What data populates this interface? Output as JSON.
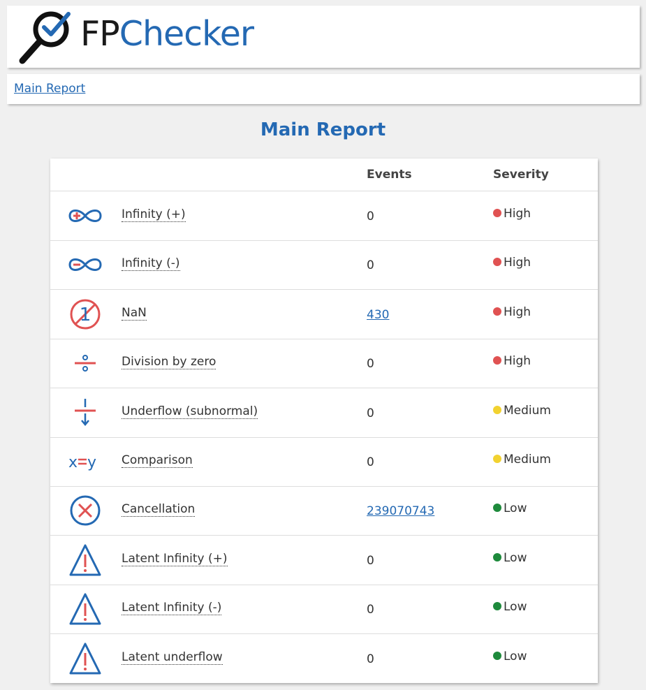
{
  "logo": {
    "fp": "FP",
    "checker": "Checker"
  },
  "nav": {
    "link": "Main Report"
  },
  "page_title": "Main Report",
  "table": {
    "headers": {
      "category": "",
      "events": "Events",
      "severity": "Severity"
    },
    "rows": [
      {
        "icon": "infinity-plus-icon",
        "category": "Infinity (+)",
        "events": "0",
        "events_link": false,
        "severity": "High",
        "severity_color": "#e05252"
      },
      {
        "icon": "infinity-minus-icon",
        "category": "Infinity (-)",
        "events": "0",
        "events_link": false,
        "severity": "High",
        "severity_color": "#e05252"
      },
      {
        "icon": "nan-icon",
        "category": "NaN",
        "events": "430",
        "events_link": true,
        "severity": "High",
        "severity_color": "#e05252"
      },
      {
        "icon": "division-icon",
        "category": "Division by zero",
        "events": "0",
        "events_link": false,
        "severity": "High",
        "severity_color": "#e05252"
      },
      {
        "icon": "underflow-icon",
        "category": "Underflow (subnormal)",
        "events": "0",
        "events_link": false,
        "severity": "Medium",
        "severity_color": "#f2d230"
      },
      {
        "icon": "comparison-icon",
        "category": "Comparison",
        "events": "0",
        "events_link": false,
        "severity": "Medium",
        "severity_color": "#f2d230"
      },
      {
        "icon": "cancellation-icon",
        "category": "Cancellation",
        "events": "239070743",
        "events_link": true,
        "severity": "Low",
        "severity_color": "#1e8a3c"
      },
      {
        "icon": "warning-triangle-icon",
        "category": "Latent Infinity (+)",
        "events": "0",
        "events_link": false,
        "severity": "Low",
        "severity_color": "#1e8a3c"
      },
      {
        "icon": "warning-triangle-icon",
        "category": "Latent Infinity (-)",
        "events": "0",
        "events_link": false,
        "severity": "Low",
        "severity_color": "#1e8a3c"
      },
      {
        "icon": "warning-triangle-icon",
        "category": "Latent underflow",
        "events": "0",
        "events_link": false,
        "severity": "Low",
        "severity_color": "#1e8a3c"
      }
    ]
  },
  "colors": {
    "brand_blue": "#2469b3",
    "accent_red": "#e05252"
  }
}
